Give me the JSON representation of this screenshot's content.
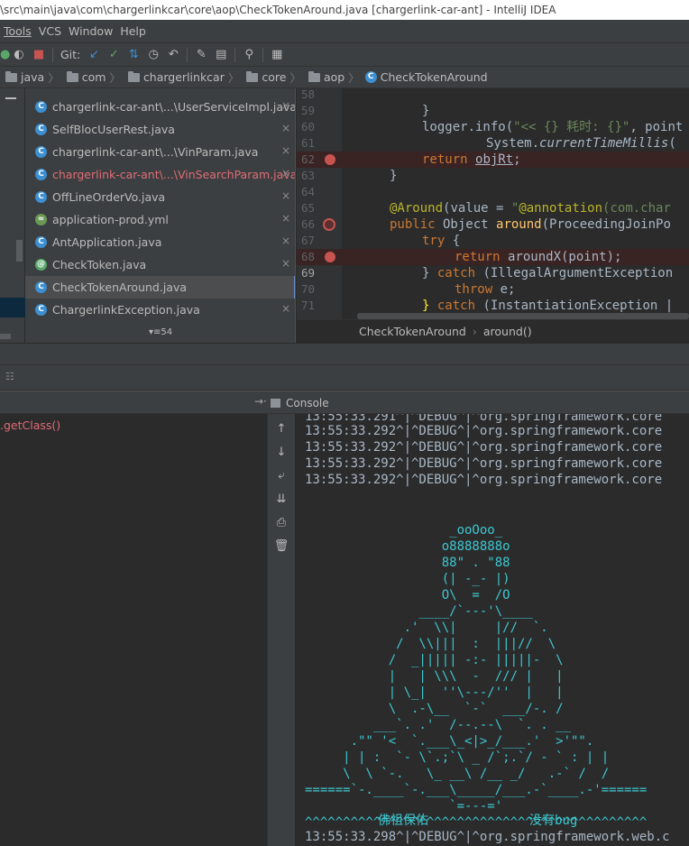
{
  "window": {
    "title": "\\src\\main\\java\\com\\chargerlinkcar\\core\\aop\\CheckTokenAround.java [chargerlink-car-ant] - IntelliJ IDEA"
  },
  "menu": {
    "tools": "Tools",
    "vcs": "VCS",
    "window": "Window",
    "help": "Help",
    "git_label": "Git:"
  },
  "nav": {
    "crumbs": [
      "java",
      "com",
      "chargerlinkcar",
      "core",
      "aop"
    ],
    "file": "CheckTokenAround"
  },
  "files": [
    {
      "name": "chargerlink-car-ant\\...\\UserServiceImpl.java",
      "icon": "class-icon",
      "error": false
    },
    {
      "name": "SelfBlocUserRest.java",
      "icon": "class-icon",
      "error": false
    },
    {
      "name": "chargerlink-car-ant\\...\\VinParam.java",
      "icon": "class-icon",
      "error": false
    },
    {
      "name": "chargerlink-car-ant\\...\\VinSearchParam.java",
      "icon": "class-icon",
      "error": true
    },
    {
      "name": "OffLineOrderVo.java",
      "icon": "class-icon",
      "error": false
    },
    {
      "name": "application-prod.yml",
      "icon": "yaml-icon",
      "error": false
    },
    {
      "name": "AntApplication.java",
      "icon": "spring-class-icon",
      "error": false
    },
    {
      "name": "CheckToken.java",
      "icon": "annotation-icon",
      "error": false
    },
    {
      "name": "CheckTokenAround.java",
      "icon": "class-icon",
      "error": false,
      "selected": true
    },
    {
      "name": "ChargerlinkException.java",
      "icon": "class-icon",
      "error": false
    }
  ],
  "files_more": "▾≡54",
  "editor": {
    "line_numbers": [
      "58",
      "59",
      "60",
      "61",
      "62",
      "63",
      "64",
      "65",
      "66",
      "67",
      "68",
      "69",
      "70",
      "71"
    ],
    "breadcrumb": [
      "CheckTokenAround",
      "around()"
    ]
  },
  "debug": {
    "console_tab": "Console",
    "frame": ".getClass()"
  },
  "console": {
    "lines_top": [
      "13:55:33.291^|^DEBUG^|^org.springframework.core",
      "13:55:33.292^|^DEBUG^|^org.springframework.core",
      "13:55:33.292^|^DEBUG^|^org.springframework.core",
      "13:55:33.292^|^DEBUG^|^org.springframework.core",
      "13:55:33.292^|^DEBUG^|^org.springframework.core"
    ],
    "art": [
      "                   _ooOoo_",
      "                  o8888888o",
      "                  88\" . \"88",
      "                  (| -_- |)",
      "                  O\\  =  /O",
      "               ____/`---'\\____",
      "             .'  \\\\|     |//  `.",
      "            /  \\\\|||  :  |||//  \\",
      "           /  _||||| -:- |||||-  \\",
      "           |   | \\\\\\  -  /// |   |",
      "           | \\_|  ''\\---/''  |   |",
      "           \\  .-\\__  `-`  ___/-. /",
      "         ___`. .'  /--.--\\  `. . __",
      "      .\"\" '<  `.___\\_<|>_/___.'  >'\"\".",
      "     | | :  `- \\`.;`\\ _ /`;.`/ - ` : | |",
      "     \\  \\ `-.   \\_ __\\ /__ _/   .-` /  /",
      "======`-.____`-.___\\_____/___.-`____.-'======",
      "                   `=---='",
      "^^^^^^^^^^^^^^^^^^^^^^^^^^^^^^^^^^^^^^^^^^^^^"
    ],
    "blessing_left": "佛祖保佑",
    "blessing_right": "没有bug",
    "last_line": "13:55:33.298^|^DEBUG^|^org.springframework.web.c"
  }
}
